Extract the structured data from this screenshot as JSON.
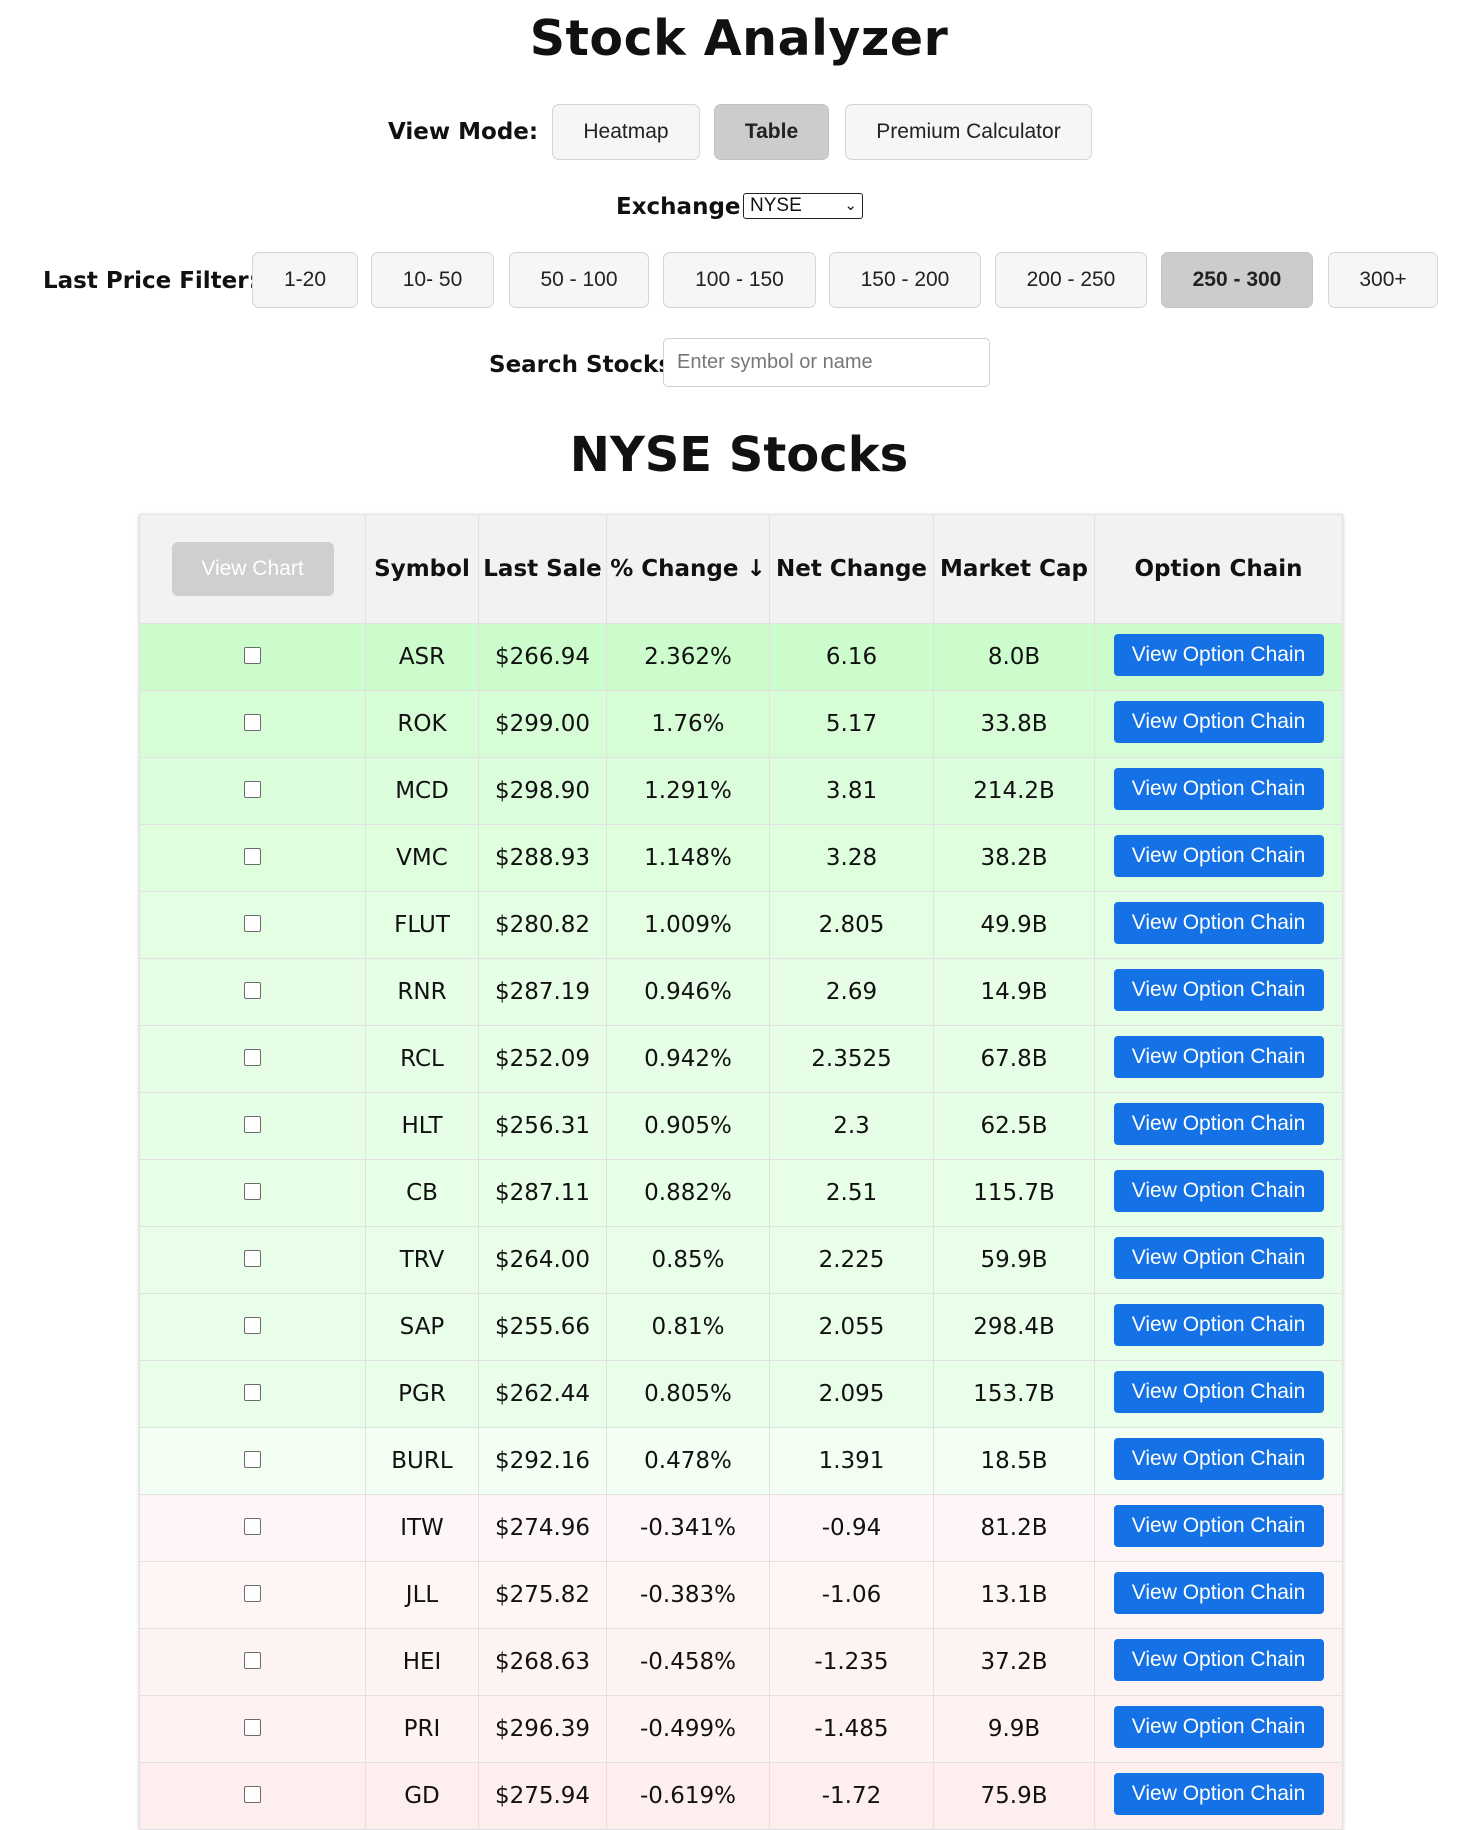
{
  "app": {
    "title": "Stock Analyzer"
  },
  "controls": {
    "view_mode_label": "View Mode:",
    "view_modes": [
      {
        "label": "Heatmap",
        "active": false
      },
      {
        "label": "Table",
        "active": true
      },
      {
        "label": "Premium Calculator",
        "active": false
      }
    ],
    "exchange_label": "Exchange:",
    "exchange_value": "NYSE",
    "price_filter_label": "Last Price Filter:",
    "price_filters": [
      {
        "label": "1-20",
        "active": false
      },
      {
        "label": "10- 50",
        "active": false
      },
      {
        "label": "50 - 100",
        "active": false
      },
      {
        "label": "100 - 150",
        "active": false
      },
      {
        "label": "150 - 200",
        "active": false
      },
      {
        "label": "200 - 250",
        "active": false
      },
      {
        "label": "250 - 300",
        "active": true
      },
      {
        "label": "300+",
        "active": false
      }
    ],
    "search_label": "Search Stocks:",
    "search_placeholder": "Enter symbol or name",
    "search_value": ""
  },
  "section": {
    "title": "NYSE Stocks"
  },
  "table": {
    "view_chart_label": "View Chart",
    "headers": {
      "symbol": "Symbol",
      "last_sale": "Last Sale",
      "pct_change": "% Change ↓",
      "net_change": "Net Change",
      "market_cap": "Market Cap",
      "option_chain": "Option Chain"
    },
    "option_button_label": "View Option Chain",
    "row_colors": {
      "positive": [
        "#ccfccc",
        "#d7fdd7",
        "#dcfddc",
        "#defede",
        "#e3fee3",
        "#e5fee5",
        "#e5fee5",
        "#e6fee6",
        "#e7fee7",
        "#e8fee8",
        "#e9fee9",
        "#e9fee9",
        "#f2fff2"
      ],
      "negative": [
        "#fef6f6",
        "#fef5f5",
        "#fef3f3",
        "#fef2f2",
        "#feeeee"
      ]
    },
    "rows": [
      {
        "symbol": "ASR",
        "last_sale": "$266.94",
        "pct_change": "2.362%",
        "net_change": "6.16",
        "market_cap": "8.0B",
        "checked": false
      },
      {
        "symbol": "ROK",
        "last_sale": "$299.00",
        "pct_change": "1.76%",
        "net_change": "5.17",
        "market_cap": "33.8B",
        "checked": false
      },
      {
        "symbol": "MCD",
        "last_sale": "$298.90",
        "pct_change": "1.291%",
        "net_change": "3.81",
        "market_cap": "214.2B",
        "checked": false
      },
      {
        "symbol": "VMC",
        "last_sale": "$288.93",
        "pct_change": "1.148%",
        "net_change": "3.28",
        "market_cap": "38.2B",
        "checked": false
      },
      {
        "symbol": "FLUT",
        "last_sale": "$280.82",
        "pct_change": "1.009%",
        "net_change": "2.805",
        "market_cap": "49.9B",
        "checked": false
      },
      {
        "symbol": "RNR",
        "last_sale": "$287.19",
        "pct_change": "0.946%",
        "net_change": "2.69",
        "market_cap": "14.9B",
        "checked": false
      },
      {
        "symbol": "RCL",
        "last_sale": "$252.09",
        "pct_change": "0.942%",
        "net_change": "2.3525",
        "market_cap": "67.8B",
        "checked": false
      },
      {
        "symbol": "HLT",
        "last_sale": "$256.31",
        "pct_change": "0.905%",
        "net_change": "2.3",
        "market_cap": "62.5B",
        "checked": false
      },
      {
        "symbol": "CB",
        "last_sale": "$287.11",
        "pct_change": "0.882%",
        "net_change": "2.51",
        "market_cap": "115.7B",
        "checked": false
      },
      {
        "symbol": "TRV",
        "last_sale": "$264.00",
        "pct_change": "0.85%",
        "net_change": "2.225",
        "market_cap": "59.9B",
        "checked": false
      },
      {
        "symbol": "SAP",
        "last_sale": "$255.66",
        "pct_change": "0.81%",
        "net_change": "2.055",
        "market_cap": "298.4B",
        "checked": false
      },
      {
        "symbol": "PGR",
        "last_sale": "$262.44",
        "pct_change": "0.805%",
        "net_change": "2.095",
        "market_cap": "153.7B",
        "checked": false
      },
      {
        "symbol": "BURL",
        "last_sale": "$292.16",
        "pct_change": "0.478%",
        "net_change": "1.391",
        "market_cap": "18.5B",
        "checked": false
      },
      {
        "symbol": "ITW",
        "last_sale": "$274.96",
        "pct_change": "-0.341%",
        "net_change": "-0.94",
        "market_cap": "81.2B",
        "checked": false
      },
      {
        "symbol": "JLL",
        "last_sale": "$275.82",
        "pct_change": "-0.383%",
        "net_change": "-1.06",
        "market_cap": "13.1B",
        "checked": false
      },
      {
        "symbol": "HEI",
        "last_sale": "$268.63",
        "pct_change": "-0.458%",
        "net_change": "-1.235",
        "market_cap": "37.2B",
        "checked": false
      },
      {
        "symbol": "PRI",
        "last_sale": "$296.39",
        "pct_change": "-0.499%",
        "net_change": "-1.485",
        "market_cap": "9.9B",
        "checked": false
      },
      {
        "symbol": "GD",
        "last_sale": "$275.94",
        "pct_change": "-0.619%",
        "net_change": "-1.72",
        "market_cap": "75.9B",
        "checked": false
      }
    ]
  }
}
